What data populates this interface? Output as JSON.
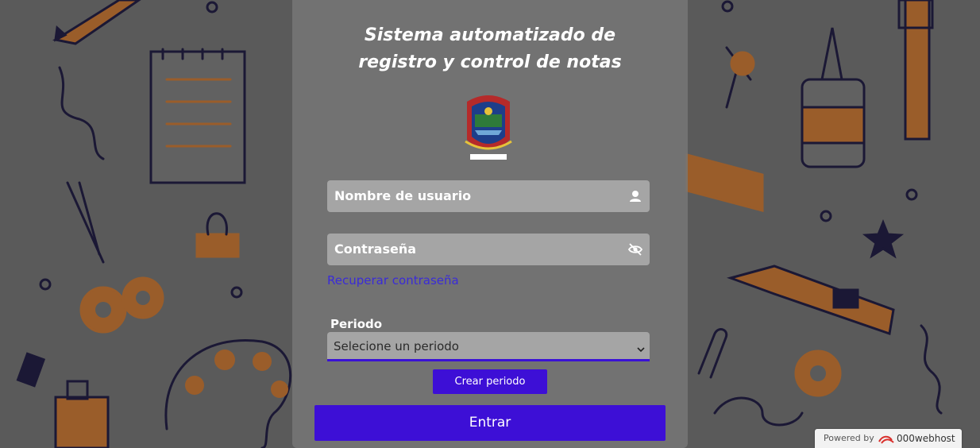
{
  "title": "Sistema automatizado de registro y control de notas",
  "logo": {
    "icon": "school-crest-logo"
  },
  "username": {
    "placeholder": "Nombre de usuario",
    "icon": "user-icon"
  },
  "password": {
    "placeholder": "Contraseña",
    "icon": "eye-slash-icon"
  },
  "recover_link": "Recuperar contraseña",
  "period": {
    "label": "Periodo",
    "selected": "Selecione un periodo",
    "icon": "chevron-down-icon"
  },
  "create_period_label": "Crear periodo",
  "submit_label": "Entrar",
  "footer": {
    "powered_by": "Powered by",
    "host": "000webhost"
  },
  "colors": {
    "accent": "#3d0fd6",
    "link": "#3a2bd8",
    "field_bg": "#a5a5a5",
    "doodle_orange": "#a8652e",
    "doodle_navy": "#1e1b3a"
  }
}
